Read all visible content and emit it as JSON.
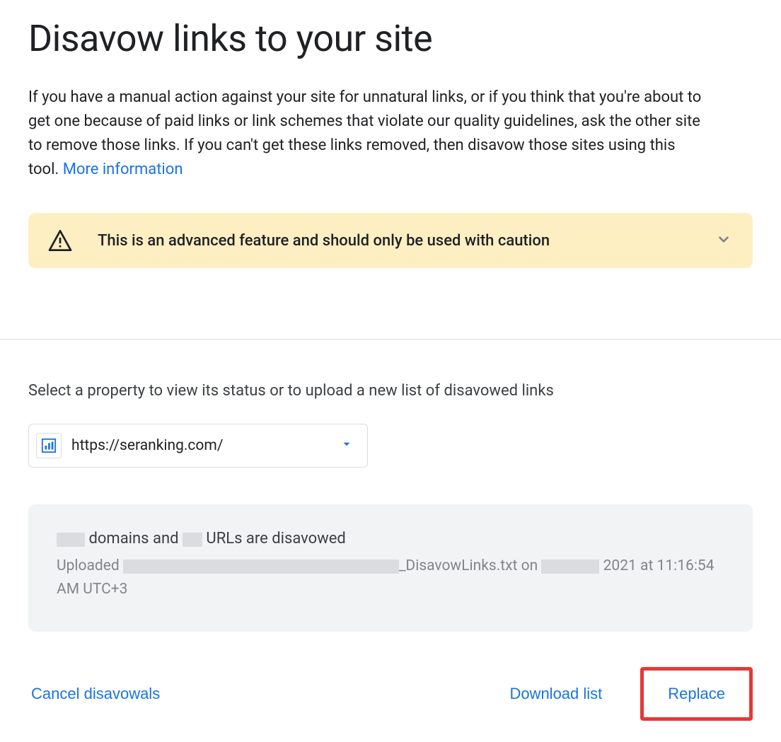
{
  "header": {
    "title": "Disavow links to your site",
    "intro_text": "If you have a manual action against your site for unnatural links, or if you think that you're about to get one because of paid links or link schemes that violate our quality guidelines, ask the other site to remove those links. If you can't get these links removed, then disavow those sites using this tool. ",
    "more_info_label": "More information"
  },
  "warning": {
    "text": "This is an advanced feature and should only be used with caution"
  },
  "property": {
    "select_label": "Select a property to view its status or to upload a new list of disavowed links",
    "selected_value": "https://seranking.com/"
  },
  "status": {
    "line1_part1": " domains and ",
    "line1_part2": " URLs are disavowed",
    "line2_prefix": "Uploaded ",
    "line2_filename_suffix": "_DisavowLinks.txt on ",
    "line2_after_date": " 2021 at 11:16:54 AM UTC+3"
  },
  "actions": {
    "cancel_label": "Cancel disavowals",
    "download_label": "Download list",
    "replace_label": "Replace"
  }
}
